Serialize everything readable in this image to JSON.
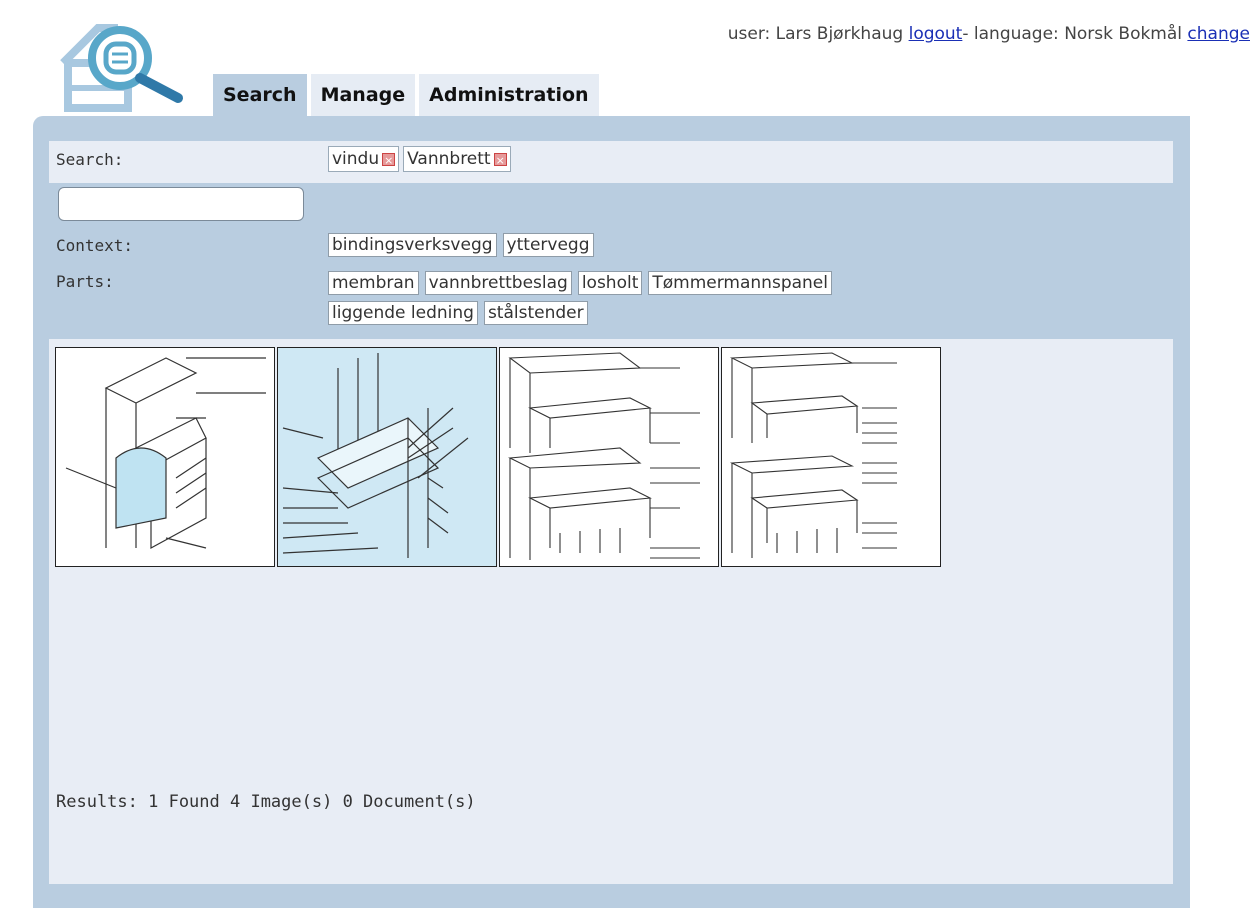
{
  "header": {
    "user_label": "user:",
    "user_name": "Lars Bjørkhaug",
    "logout_label": "logout",
    "language_label": "- language:",
    "language_value": "Norsk Bokmål",
    "change_label": "change"
  },
  "tabs": [
    {
      "label": "Search",
      "active": true
    },
    {
      "label": "Manage",
      "active": false
    },
    {
      "label": "Administration",
      "active": false
    }
  ],
  "search": {
    "label": "Search:",
    "terms": [
      "vindu",
      "Vannbrett"
    ],
    "input_value": ""
  },
  "context": {
    "label": "Context:",
    "tags": [
      "bindingsverksvegg",
      "yttervegg"
    ]
  },
  "parts": {
    "label": "Parts:",
    "tags": [
      "membran",
      "vannbrettbeslag",
      "losholt",
      "Tømmermannspanel",
      "liggende ledning",
      "stålstender"
    ]
  },
  "results": {
    "thumbnails": [
      {
        "name": "drawing-1",
        "selected": false
      },
      {
        "name": "drawing-2",
        "selected": true
      },
      {
        "name": "drawing-3",
        "selected": false
      },
      {
        "name": "drawing-4",
        "selected": false
      }
    ],
    "summary": "Results: 1 Found 4 Image(s) 0 Document(s)"
  },
  "colors": {
    "panel": "#b9cde0",
    "band": "#e8edf5",
    "accent": "#58a7c9"
  }
}
